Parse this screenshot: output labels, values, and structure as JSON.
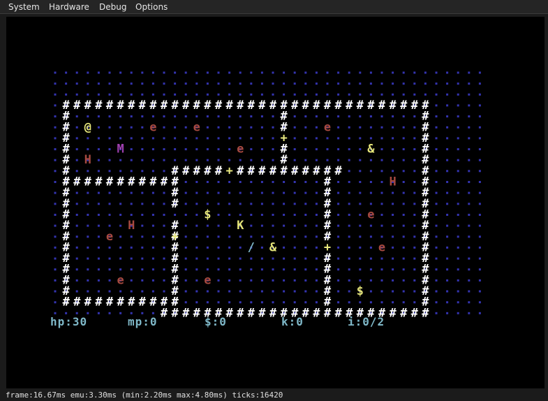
{
  "menubar": {
    "items": [
      {
        "label": "System"
      },
      {
        "label": "Hardware"
      },
      {
        "label": "Debug"
      },
      {
        "label": "Options"
      }
    ]
  },
  "colors": {
    "background": "#000000",
    "dot": "#3434b0",
    "wall": "#ffffff",
    "player": "#e6e67a",
    "enemy_e": "#a84a40",
    "enemy_H": "#a84a40",
    "enemy_M": "#a040b0",
    "item_yellow": "#e6e67a",
    "item_door": "#e6e67a",
    "hud": "#7fb8c8"
  },
  "map": {
    "glyphs": [
      {
        "ch": "@",
        "kind": "player"
      },
      {
        "ch": "e",
        "kind": "enemy_e"
      },
      {
        "ch": "e",
        "kind": "enemy_e"
      },
      {
        "ch": "e",
        "kind": "enemy_e"
      },
      {
        "ch": "e",
        "kind": "enemy_e"
      },
      {
        "ch": "M",
        "kind": "enemy_M"
      },
      {
        "ch": "H",
        "kind": "enemy_H"
      },
      {
        "ch": "&",
        "kind": "item_yellow"
      },
      {
        "ch": "H",
        "kind": "enemy_H"
      },
      {
        "ch": "$",
        "kind": "item_yellow"
      },
      {
        "ch": "K",
        "kind": "item_yellow"
      },
      {
        "ch": "H",
        "kind": "enemy_H"
      },
      {
        "ch": "e",
        "kind": "enemy_e"
      },
      {
        "ch": "e",
        "kind": "enemy_e"
      },
      {
        "ch": "/",
        "kind": "item_weapon"
      },
      {
        "ch": "&",
        "kind": "item_yellow"
      },
      {
        "ch": "e",
        "kind": "enemy_e"
      },
      {
        "ch": "e",
        "kind": "enemy_e"
      },
      {
        "ch": "e",
        "kind": "enemy_e"
      },
      {
        "ch": "$",
        "kind": "item_yellow"
      },
      {
        "ch": "+",
        "kind": "door"
      },
      {
        "ch": "+",
        "kind": "door"
      },
      {
        "ch": "+",
        "kind": "door"
      },
      {
        "ch": "+",
        "kind": "door"
      }
    ]
  },
  "hud": {
    "hp": "hp:30",
    "mp": "mp:0",
    "gold": "$:0",
    "keys": "k:0",
    "items": "i:0/2"
  },
  "status": {
    "text": "frame:16.67ms emu:3.30ms (min:2.20ms max:4.80ms) ticks:16420"
  }
}
